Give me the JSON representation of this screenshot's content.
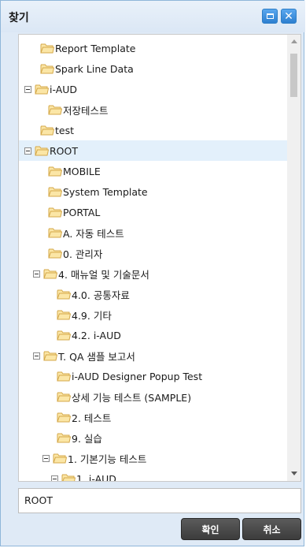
{
  "dialog": {
    "title": "찾기"
  },
  "tree": {
    "items": [
      {
        "label": "Report Template",
        "toggle": false,
        "selected": false
      },
      {
        "label": "Spark Line Data",
        "toggle": false,
        "selected": false
      },
      {
        "label": "i-AUD",
        "toggle": true,
        "selected": false
      },
      {
        "label": "저장테스트",
        "toggle": false,
        "selected": false
      },
      {
        "label": "test",
        "toggle": false,
        "selected": false
      },
      {
        "label": "ROOT",
        "toggle": true,
        "selected": true
      },
      {
        "label": "MOBILE",
        "toggle": false,
        "selected": false
      },
      {
        "label": "System Template",
        "toggle": false,
        "selected": false
      },
      {
        "label": "PORTAL",
        "toggle": false,
        "selected": false
      },
      {
        "label": "A. 자동 테스트",
        "toggle": false,
        "selected": false
      },
      {
        "label": "0. 관리자",
        "toggle": false,
        "selected": false
      },
      {
        "label": "4. 매뉴얼 및 기술문서",
        "toggle": true,
        "selected": false
      },
      {
        "label": "4.0. 공통자료",
        "toggle": false,
        "selected": false
      },
      {
        "label": "4.9. 기타",
        "toggle": false,
        "selected": false
      },
      {
        "label": "4.2. i-AUD",
        "toggle": false,
        "selected": false
      },
      {
        "label": "T. QA 샘플 보고서",
        "toggle": true,
        "selected": false
      },
      {
        "label": "i-AUD Designer Popup Test",
        "toggle": false,
        "selected": false
      },
      {
        "label": "상세 기능 테스트 (SAMPLE)",
        "toggle": false,
        "selected": false
      },
      {
        "label": "2. 테스트",
        "toggle": false,
        "selected": false
      },
      {
        "label": "9. 실습",
        "toggle": false,
        "selected": false
      },
      {
        "label": "1. 기본기능 테스트",
        "toggle": true,
        "selected": false
      },
      {
        "label": "1. i-AUD",
        "toggle": true,
        "selected": false
      }
    ]
  },
  "path": {
    "value": "ROOT"
  },
  "buttons": {
    "ok": "확인",
    "cancel": "취소"
  },
  "colors": {
    "folder_fill": "#fbe6a6",
    "folder_stroke": "#d4a84a",
    "selection": "#e3f0fb",
    "title_button": "#2c7fd0"
  }
}
